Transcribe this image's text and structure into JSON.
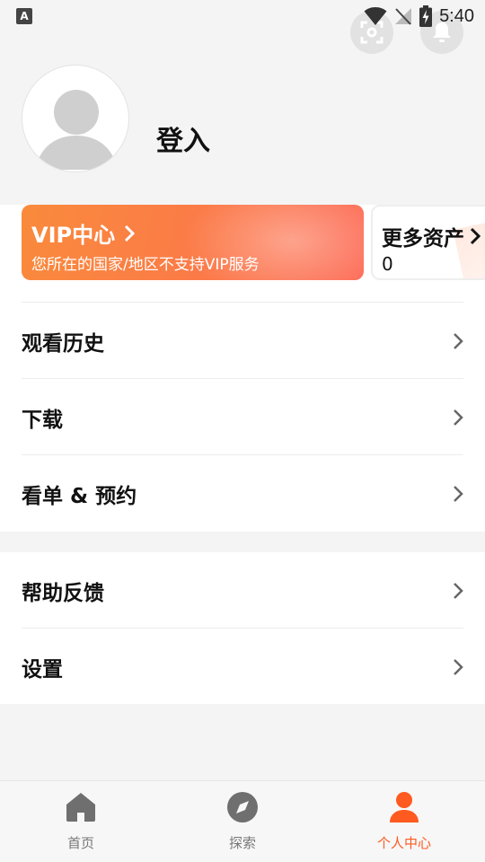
{
  "status_bar": {
    "time": "5:40",
    "left_icon": "A"
  },
  "header": {
    "login_text": "登入",
    "scan_icon": "scan-icon",
    "bell_icon": "bell-icon"
  },
  "vip": {
    "title": "VIP中心",
    "subtitle": "您所在的国家/地区不支持VIP服务"
  },
  "assets": {
    "title": "更多资产",
    "value": "0"
  },
  "menu_group_1": [
    {
      "label": "观看历史"
    },
    {
      "label": "下载"
    },
    {
      "label": "看单 & 预约"
    }
  ],
  "menu_group_2": [
    {
      "label": "帮助反馈"
    },
    {
      "label": "设置"
    }
  ],
  "bottom_nav": {
    "items": [
      {
        "label": "首页",
        "icon": "home-icon"
      },
      {
        "label": "探索",
        "icon": "compass-icon"
      },
      {
        "label": "个人中心",
        "icon": "person-icon"
      }
    ],
    "active_index": 2
  },
  "colors": {
    "accent": "#ff5a1f",
    "vip_gradient_start": "#f98a3c",
    "vip_gradient_end": "#fd6a55"
  }
}
